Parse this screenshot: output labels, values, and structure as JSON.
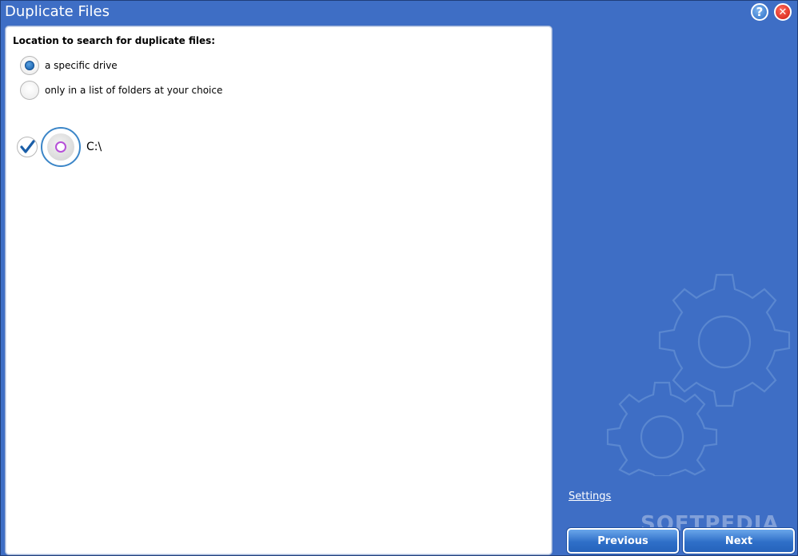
{
  "window": {
    "title": "Duplicate Files"
  },
  "titlebar": {
    "help_glyph": "?",
    "close_glyph": "✕"
  },
  "location": {
    "heading": "Location to search for duplicate files:",
    "options": [
      {
        "label": "a specific drive",
        "selected": true
      },
      {
        "label": "only in a list of folders at your choice",
        "selected": false
      }
    ]
  },
  "drives": [
    {
      "label": "C:\\",
      "checked": true,
      "icon": "disc-drive-icon"
    }
  ],
  "sidebar": {
    "settings_label": "Settings",
    "watermark": "SOFTPEDIA"
  },
  "buttons": {
    "previous": "Previous",
    "next": "Next"
  },
  "colors": {
    "background": "#3e6ec5",
    "panel": "#ffffff",
    "accent": "#0f5aa8"
  }
}
